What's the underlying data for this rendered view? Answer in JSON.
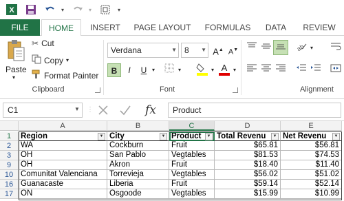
{
  "ribbon_tabs": [
    "FILE",
    "HOME",
    "INSERT",
    "PAGE LAYOUT",
    "FORMULAS",
    "DATA",
    "REVIEW"
  ],
  "clipboard": {
    "paste_label": "Paste",
    "cut_label": "Cut",
    "copy_label": "Copy",
    "format_painter_label": "Format Painter",
    "group_label": "Clipboard"
  },
  "font": {
    "name": "Verdana",
    "size": "8",
    "bold": "B",
    "italic": "I",
    "underline": "U",
    "group_label": "Font"
  },
  "alignment": {
    "group_label": "Alignment"
  },
  "formula_bar": {
    "name_box": "C1",
    "fx_label": "fx",
    "content": "Product"
  },
  "columns": [
    "A",
    "B",
    "C",
    "D",
    "E"
  ],
  "row_numbers": [
    "1",
    "2",
    "3",
    "9",
    "10",
    "16",
    "17"
  ],
  "table": {
    "headers": [
      "Region",
      "City",
      "Product",
      "Total Revenu",
      "Net Revenu"
    ],
    "rows": [
      [
        "WA",
        "Cockburn",
        "Fruit",
        "$65.81",
        "$56.81"
      ],
      [
        "OH",
        "San Pablo",
        "Vegtables",
        "$81.53",
        "$74.53"
      ],
      [
        "OH",
        "Akron",
        "Fruit",
        "$18.40",
        "$11.40"
      ],
      [
        "Comunitat Valenciana",
        "Torrevieja",
        "Vegtables",
        "$56.02",
        "$51.02"
      ],
      [
        "Guanacaste",
        "Liberia",
        "Fruit",
        "$59.14",
        "$52.14"
      ],
      [
        "ON",
        "Osgoode",
        "Vegtables",
        "$15.99",
        "$10.99"
      ]
    ]
  },
  "colors": {
    "file_tab": "#217346",
    "accent": "#217346",
    "row_header_text": "#2b5797"
  }
}
